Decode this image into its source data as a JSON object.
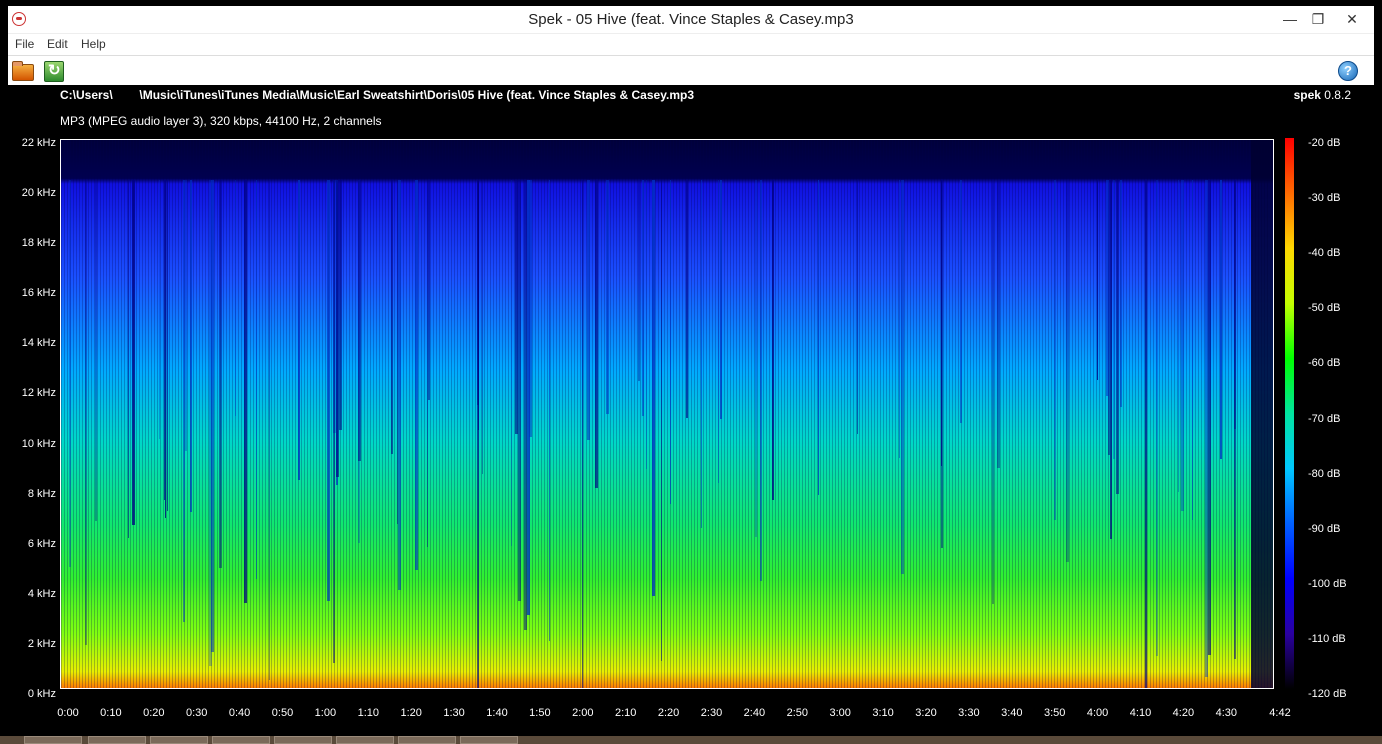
{
  "window": {
    "title": "Spek - 05 Hive (feat. Vince Staples & Casey.mp3",
    "controls": {
      "minimize": "—",
      "maximize": "❐",
      "close": "✕"
    }
  },
  "menu": {
    "file": "File",
    "edit": "Edit",
    "help": "Help"
  },
  "toolbar": {
    "open_icon": "folder-open-icon",
    "save_icon": "save-icon",
    "help_icon": "help-icon",
    "help_glyph": "?"
  },
  "file": {
    "path": "C:\\Users\\        \\Music\\iTunes\\iTunes Media\\Music\\Earl Sweatshirt\\Doris\\05 Hive (feat. Vince Staples & Casey.mp3",
    "info": "MP3 (MPEG audio layer 3), 320 kbps, 44100 Hz, 2 channels"
  },
  "brand": {
    "name": "spek",
    "version": "0.8.2"
  },
  "frequency_axis": [
    "22 kHz",
    "20 kHz",
    "18 kHz",
    "16 kHz",
    "14 kHz",
    "12 kHz",
    "10 kHz",
    "8 kHz",
    "6 kHz",
    "4 kHz",
    "2 kHz",
    "0 kHz"
  ],
  "time_axis": [
    "0:00",
    "0:10",
    "0:20",
    "0:30",
    "0:40",
    "0:50",
    "1:00",
    "1:10",
    "1:20",
    "1:30",
    "1:40",
    "1:50",
    "2:00",
    "2:10",
    "2:20",
    "2:30",
    "2:40",
    "2:50",
    "3:00",
    "3:10",
    "3:20",
    "3:30",
    "3:40",
    "3:50",
    "4:00",
    "4:10",
    "4:20",
    "4:30",
    "4:42"
  ],
  "db_scale": [
    "-20 dB",
    "-30 dB",
    "-40 dB",
    "-50 dB",
    "-60 dB",
    "-70 dB",
    "-80 dB",
    "-90 dB",
    "-100 dB",
    "-110 dB",
    "-120 dB"
  ],
  "colors": {
    "background": "#000000",
    "axis": "#ffffff",
    "low_energy": "#0000c8",
    "mid_energy": "#00ff40",
    "high_energy": "#ff6a00"
  }
}
